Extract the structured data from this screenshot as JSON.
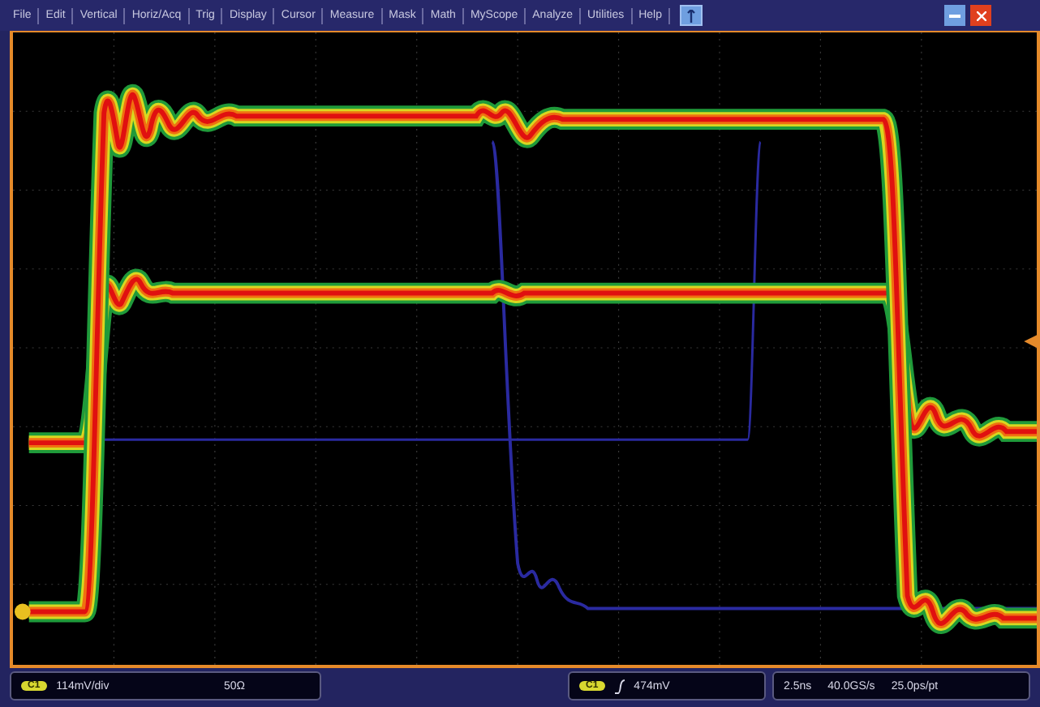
{
  "menu_bar": {
    "items": [
      {
        "label": "File"
      },
      {
        "label": "Edit"
      },
      {
        "label": "Vertical"
      },
      {
        "label": "Horiz/Acq"
      },
      {
        "label": "Trig"
      },
      {
        "label": "Display"
      },
      {
        "label": "Cursor"
      },
      {
        "label": "Measure"
      },
      {
        "label": "Mask"
      },
      {
        "label": "Math"
      },
      {
        "label": "MyScope"
      },
      {
        "label": "Analyze"
      },
      {
        "label": "Utilities"
      },
      {
        "label": "Help"
      }
    ]
  },
  "display": {
    "kind": "persistence"
  },
  "status_bar": {
    "channel": {
      "badge": "C1",
      "scale": "114mV/div",
      "termination": "50Ω"
    },
    "trigger": {
      "badge": "C1",
      "level": "474mV"
    },
    "timebase": {
      "scale": "2.5ns",
      "sample_rate": "40.0GS/s",
      "resolution": "25.0ps/pt"
    }
  }
}
